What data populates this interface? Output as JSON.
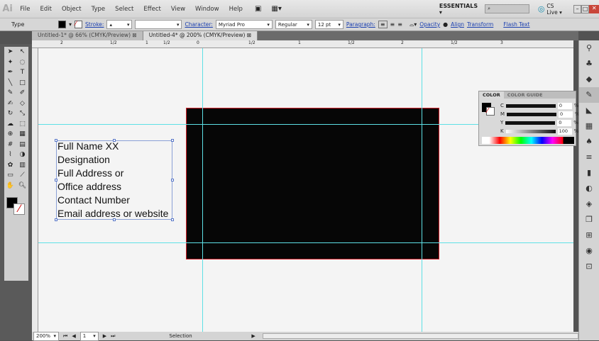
{
  "menubar": {
    "logo": "Ai",
    "items": [
      "File",
      "Edit",
      "Object",
      "Type",
      "Select",
      "Effect",
      "View",
      "Window",
      "Help"
    ],
    "workspace": "ESSENTIALS ▾",
    "search_placeholder": "",
    "cs_live": "CS Live ▾"
  },
  "control": {
    "mode": "Type",
    "stroke_label": "Stroke:",
    "character_label": "Character:",
    "font": "Myriad Pro",
    "style": "Regular",
    "size": "12 pt",
    "paragraph_label": "Paragraph:",
    "opacity_label": "Opacity",
    "align_label": "Align",
    "transform_label": "Transform",
    "flash_label": "Flash Text"
  },
  "tabs": [
    {
      "label": "Untitled-1* @ 66% (CMYK/Preview)",
      "active": false
    },
    {
      "label": "Untitled-4* @ 200% (CMYK/Preview)",
      "active": true
    }
  ],
  "ruler": {
    "labels": [
      "2",
      "1/2",
      "1",
      "1/2",
      "0",
      "1/2",
      "1",
      "1/2",
      "2",
      "1/2",
      "3"
    ]
  },
  "textbox": {
    "lines": [
      "Full Name XX",
      "Designation",
      "Full Address or",
      "Office address",
      "Contact Number",
      "Email address or website"
    ]
  },
  "color_panel": {
    "tabs": [
      "COLOR",
      "COLOR GUIDE"
    ],
    "channels": [
      {
        "label": "C",
        "value": "0"
      },
      {
        "label": "M",
        "value": "0"
      },
      {
        "label": "Y",
        "value": "0"
      },
      {
        "label": "K",
        "value": "100"
      }
    ],
    "unit": "%"
  },
  "status": {
    "zoom": "200%",
    "page": "1",
    "tool": "Selection"
  },
  "colors": {
    "artboard": "#060606",
    "artboard_border": "#d0202a",
    "guide": "#5ee0e6"
  }
}
